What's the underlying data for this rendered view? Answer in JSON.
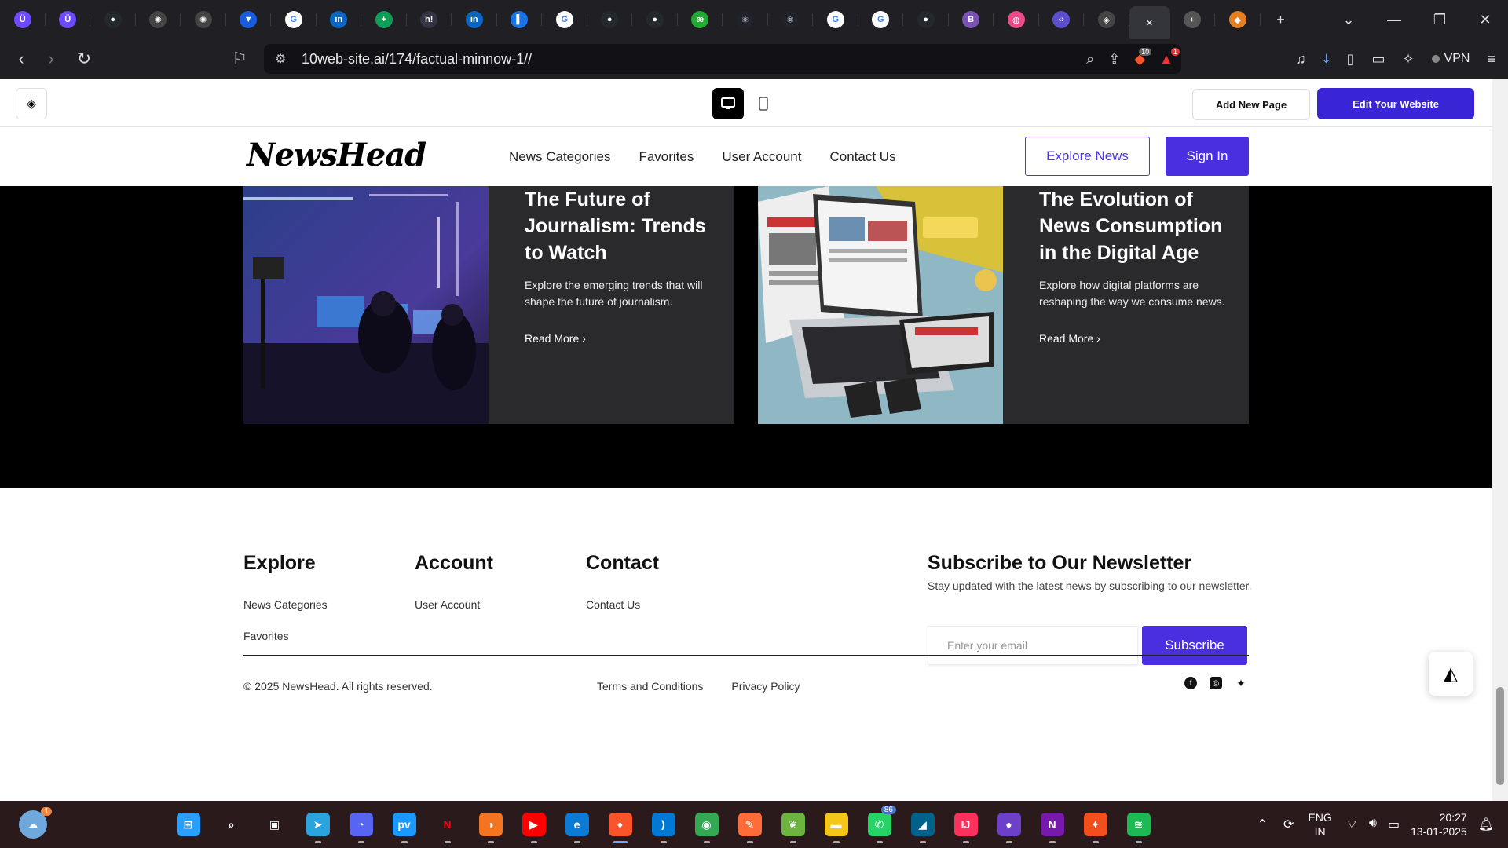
{
  "browser": {
    "tabs": [
      {
        "icon": "proton-vpn-icon",
        "glyph": "Ü",
        "color": "#6d4aff"
      },
      {
        "icon": "proton-vpn-icon",
        "glyph": "Ü",
        "color": "#6d4aff"
      },
      {
        "icon": "github-icon",
        "glyph": "●",
        "color": "#24292e"
      },
      {
        "icon": "openai-icon",
        "glyph": "✺",
        "color": "#444"
      },
      {
        "icon": "openai-icon",
        "glyph": "✺",
        "color": "#444"
      },
      {
        "icon": "bitwarden-icon",
        "glyph": "▼",
        "color": "#175ddc"
      },
      {
        "icon": "google-icon",
        "glyph": "G",
        "color": "#fff"
      },
      {
        "icon": "linkedin-icon",
        "glyph": "in",
        "color": "#0a66c2"
      },
      {
        "icon": "google-sheets-icon",
        "glyph": "+",
        "color": "#0f9d58"
      },
      {
        "icon": "hackerrank-icon",
        "glyph": "h!",
        "color": "#334"
      },
      {
        "icon": "linkedin-icon",
        "glyph": "in",
        "color": "#0a66c2"
      },
      {
        "icon": "sidebar-icon",
        "glyph": "▌",
        "color": "#1a73e8"
      },
      {
        "icon": "google-icon",
        "glyph": "G",
        "color": "#fff"
      },
      {
        "icon": "github-icon",
        "glyph": "●",
        "color": "#24292e"
      },
      {
        "icon": "github-icon",
        "glyph": "●",
        "color": "#24292e"
      },
      {
        "icon": "code-icon",
        "glyph": "æ",
        "color": "#2a3"
      },
      {
        "icon": "react-icon",
        "glyph": "⚛",
        "color": "#20232a"
      },
      {
        "icon": "react-icon",
        "glyph": "⚛",
        "color": "#20232a"
      },
      {
        "icon": "google-icon",
        "glyph": "G",
        "color": "#fff"
      },
      {
        "icon": "google-icon",
        "glyph": "G",
        "color": "#fff"
      },
      {
        "icon": "github-icon",
        "glyph": "●",
        "color": "#24292e"
      },
      {
        "icon": "bootstrap-icon",
        "glyph": "B",
        "color": "#7952b3"
      },
      {
        "icon": "dribbble-icon",
        "glyph": "◍",
        "color": "#ea4c89"
      },
      {
        "icon": "dev-icon",
        "glyph": "‹›",
        "color": "#5a4fcf"
      },
      {
        "icon": "tenweb-icon",
        "glyph": "◈",
        "color": "#444"
      },
      {
        "icon": "close-icon",
        "glyph": "✕",
        "color": "#34343b",
        "active": true
      },
      {
        "icon": "globe-icon",
        "glyph": "◐",
        "color": "#555"
      },
      {
        "icon": "colorful-icon",
        "glyph": "◆",
        "color": "#e67e22"
      }
    ],
    "url": "10web-site.ai/174/factual-minnow-1//",
    "brave_shield_count": "10",
    "brave_rewards_count": "1",
    "vpn_label": "VPN"
  },
  "editor": {
    "add_page_label": "Add New Page",
    "edit_website_label": "Edit Your Website"
  },
  "site": {
    "brand": "NewsHead",
    "nav": [
      "News Categories",
      "Favorites",
      "User Account",
      "Contact Us"
    ],
    "explore_label": "Explore News",
    "signin_label": "Sign In"
  },
  "articles": [
    {
      "title": "The Future of Journalism: Trends to Watch",
      "description": "Explore the emerging trends that will shape the future of journalism.",
      "link": "Read More ›"
    },
    {
      "title": "The Evolution of News Consumption in the Digital Age",
      "description": "Explore how digital platforms are reshaping the way we consume news.",
      "link": "Read More ›"
    }
  ],
  "footer": {
    "explore": {
      "heading": "Explore",
      "links": [
        "News Categories",
        "Favorites"
      ]
    },
    "account": {
      "heading": "Account",
      "links": [
        "User Account"
      ]
    },
    "contact": {
      "heading": "Contact",
      "links": [
        "Contact Us"
      ]
    },
    "newsletter": {
      "heading": "Subscribe to Our Newsletter",
      "text": "Stay updated with the latest news by subscribing to our newsletter.",
      "placeholder": "Enter your email",
      "button": "Subscribe"
    },
    "copyright": "© 2025 NewsHead. All rights reserved.",
    "legal": [
      "Terms and Conditions",
      "Privacy Policy"
    ],
    "socials": [
      "facebook-icon",
      "instagram-icon",
      "twitter-icon"
    ]
  },
  "taskbar": {
    "weather_badge": "1",
    "apps": [
      {
        "icon": "windows-start-icon",
        "glyph": "⊞",
        "color": "#29a0ff"
      },
      {
        "icon": "search-icon",
        "glyph": "⌕",
        "color": "transparent"
      },
      {
        "icon": "task-view-icon",
        "glyph": "▣",
        "color": "transparent"
      },
      {
        "icon": "telegram-icon",
        "glyph": "➤",
        "color": "#2aa3de"
      },
      {
        "icon": "discord-icon",
        "glyph": "◔",
        "color": "#5865f2"
      },
      {
        "icon": "prime-video-icon",
        "glyph": "pv",
        "color": "#1a98ff"
      },
      {
        "icon": "netflix-icon",
        "glyph": "N",
        "color": "transparent"
      },
      {
        "icon": "crunchyroll-icon",
        "glyph": "◑",
        "color": "#f47521"
      },
      {
        "icon": "youtube-icon",
        "glyph": "▶",
        "color": "#ff0000"
      },
      {
        "icon": "edge-icon",
        "glyph": "e",
        "color": "#0c7bd6"
      },
      {
        "icon": "brave-icon",
        "glyph": "♦",
        "color": "#fb542b",
        "active": true
      },
      {
        "icon": "vscode-icon",
        "glyph": "⟩",
        "color": "#0078d4"
      },
      {
        "icon": "chrome-icon",
        "glyph": "◉",
        "color": "#34a853"
      },
      {
        "icon": "postman-icon",
        "glyph": "✎",
        "color": "#ff6c37"
      },
      {
        "icon": "spring-icon",
        "glyph": "❦",
        "color": "#6db33f"
      },
      {
        "icon": "file-explorer-icon",
        "glyph": "▬",
        "color": "#f5c518"
      },
      {
        "icon": "whatsapp-icon",
        "glyph": "✆",
        "color": "#25d366",
        "badge": "86"
      },
      {
        "icon": "mysql-icon",
        "glyph": "◢",
        "color": "#00618a"
      },
      {
        "icon": "intellij-icon",
        "glyph": "IJ",
        "color": "#fe315d"
      },
      {
        "icon": "github-desktop-icon",
        "glyph": "●",
        "color": "#6e40c9"
      },
      {
        "icon": "onenote-icon",
        "glyph": "N",
        "color": "#7719aa"
      },
      {
        "icon": "figma-icon",
        "glyph": "✦",
        "color": "#f24e1e"
      },
      {
        "icon": "spotify-icon",
        "glyph": "≋",
        "color": "#1db954"
      }
    ],
    "lang_top": "ENG",
    "lang_bottom": "IN",
    "time": "20:27",
    "date": "13-01-2025"
  }
}
